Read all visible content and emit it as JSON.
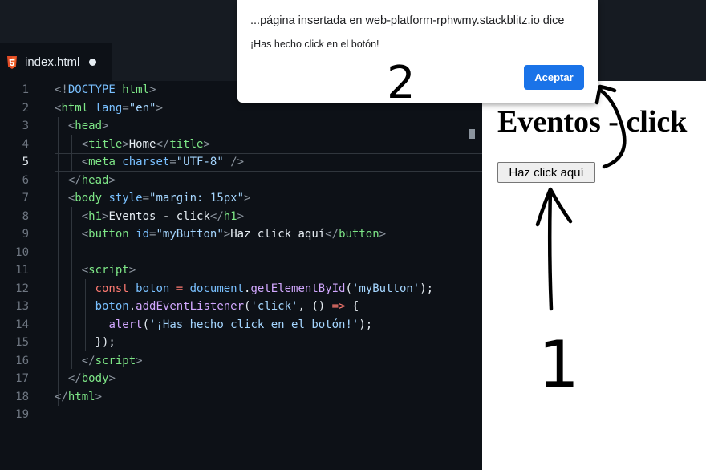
{
  "editor_tab": {
    "label": "index.html"
  },
  "url_bar": {
    "text": "web-platform-rp"
  },
  "line_numbers": [
    "1",
    "2",
    "3",
    "4",
    "5",
    "6",
    "7",
    "8",
    "9",
    "10",
    "11",
    "12",
    "13",
    "14",
    "15",
    "16",
    "17",
    "18",
    "19"
  ],
  "code": {
    "l1": {
      "open": "<!",
      "kw": "DOCTYPE",
      "rest": " html",
      "close": ">"
    },
    "l2": {
      "open": "<",
      "tag": "html",
      "attr": " lang",
      "eq": "=",
      "val": "\"en\"",
      "close": ">"
    },
    "l3": {
      "open": "<",
      "tag": "head",
      "close": ">"
    },
    "l4": {
      "open": "<",
      "tag": "title",
      "close": ">",
      "text": "Home",
      "end_open": "</",
      "end_tag": "title",
      "end_close": ">"
    },
    "l5": {
      "open": "<",
      "tag": "meta",
      "attr": " charset",
      "eq": "=",
      "val": "\"UTF-8\"",
      "close": " />"
    },
    "l6": {
      "open": "</",
      "tag": "head",
      "close": ">"
    },
    "l7": {
      "open": "<",
      "tag": "body",
      "attr": " style",
      "eq": "=",
      "val": "\"margin: 15px\"",
      "close": ">"
    },
    "l8": {
      "open": "<",
      "tag": "h1",
      "close": ">",
      "text": "Eventos - click",
      "end_open": "</",
      "end_tag": "h1",
      "end_close": ">"
    },
    "l9": {
      "open": "<",
      "tag": "button",
      "attr": " id",
      "eq": "=",
      "val": "\"myButton\"",
      "close": ">",
      "text": "Haz click aquí",
      "end_open": "</",
      "end_tag": "button",
      "end_close": ">"
    },
    "l11": {
      "open": "<",
      "tag": "script",
      "close": ">"
    },
    "l12": {
      "kw": "const",
      "var": " boton",
      "op": " = ",
      "obj": "document",
      "dot": ".",
      "fn": "getElementById",
      "p1": "(",
      "str": "'myButton'",
      "p2": ");"
    },
    "l13": {
      "var": "boton",
      "dot": ".",
      "fn": "addEventListener",
      "p1": "(",
      "str": "'click'",
      "comma": ", ",
      "args": "()",
      "arrow": " => ",
      "brace": "{"
    },
    "l14": {
      "fn": "alert",
      "p1": "(",
      "str": "'¡Has hecho click en el botón!'",
      "p2": ");"
    },
    "l15": {
      "text": "});"
    },
    "l16": {
      "open": "</",
      "tag": "script",
      "close": ">"
    },
    "l17": {
      "open": "</",
      "tag": "body",
      "close": ">"
    },
    "l18": {
      "open": "</",
      "tag": "html",
      "close": ">"
    }
  },
  "preview": {
    "heading": "Eventos - click",
    "button_label": "Haz click aquí"
  },
  "dialog": {
    "title": "...página insertada en web-platform-rphwmy.stackblitz.io dice",
    "message": "¡Has hecho click en el botón!",
    "ok_label": "Aceptar"
  },
  "annotations": {
    "step1": "1",
    "step2": "2"
  },
  "colors": {
    "accent": "#1a73e8",
    "editor_bg": "#0d1117",
    "tag": "#7ee787",
    "attr": "#79c0ff",
    "string": "#a5d6ff"
  },
  "icons": {
    "tab_icon": "html5-icon",
    "url_icon": "lock-icon"
  }
}
